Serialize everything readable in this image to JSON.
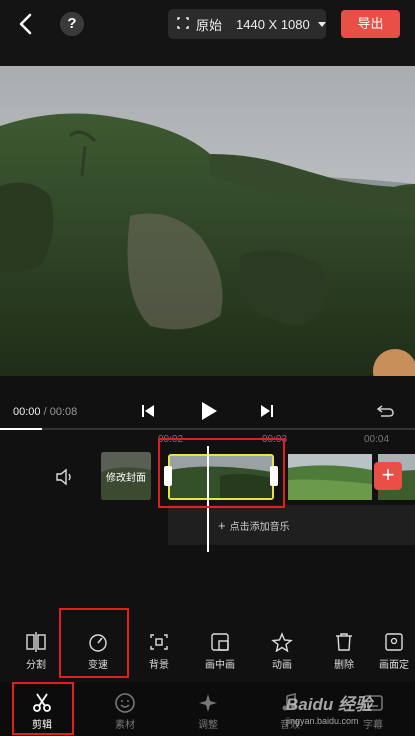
{
  "topbar": {
    "help_symbol": "?",
    "ratio_label": "原始",
    "ratio_value": "1440 X 1080",
    "export_label": "导出"
  },
  "player": {
    "current_time": "00:00",
    "separator": "/",
    "total_time": "00:08"
  },
  "timeline": {
    "ticks": [
      "00:02",
      "00:03",
      "00:04"
    ],
    "cover_label": "修改封面",
    "add_music_label": "点击添加音乐",
    "add_clip_symbol": "+"
  },
  "tools": [
    {
      "label": "分割",
      "icon": "split-icon"
    },
    {
      "label": "变速",
      "icon": "speed-gauge-icon"
    },
    {
      "label": "背景",
      "icon": "background-icon"
    },
    {
      "label": "画中画",
      "icon": "picture-in-picture-icon"
    },
    {
      "label": "动画",
      "icon": "star-animation-icon"
    },
    {
      "label": "删除",
      "icon": "trash-icon"
    },
    {
      "label": "画面定",
      "icon": "frame-icon"
    }
  ],
  "tabs": [
    {
      "label": "剪辑",
      "icon": "scissors-icon",
      "active": true
    },
    {
      "label": "素材",
      "icon": "smiley-icon",
      "active": false
    },
    {
      "label": "调整",
      "icon": "adjust-icon",
      "active": false
    },
    {
      "label": "音效",
      "icon": "music-icon",
      "active": false
    },
    {
      "label": "字幕",
      "icon": "subtitle-icon",
      "active": false
    }
  ],
  "watermark": {
    "logo_text": "Baidu 经验",
    "url": "jingyan.baidu.com"
  },
  "colors": {
    "accent": "#e84f47",
    "selection": "#e9e24a",
    "highlight_box": "#e02020",
    "background": "#111111"
  }
}
